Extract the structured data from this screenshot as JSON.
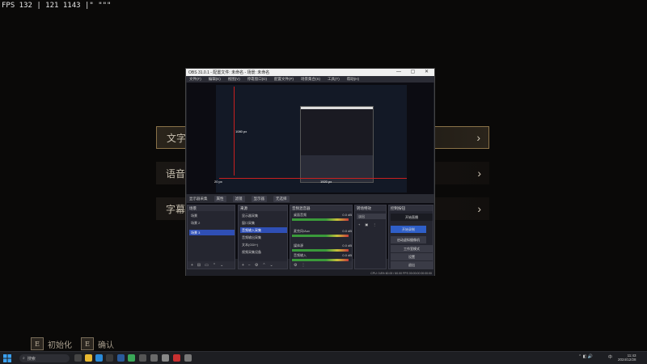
{
  "overlay": {
    "fps_text": "FPS 132 | 121 1143 |\" \"\"\""
  },
  "game_menu": {
    "items": [
      {
        "label": "文字",
        "suffix": ""
      },
      {
        "label": "语音",
        "suffix": ""
      },
      {
        "label": "字幕",
        "suffix": ""
      }
    ],
    "options": [
      {
        "key": "E",
        "label": "初始化"
      },
      {
        "key": "E",
        "label": "确认"
      }
    ]
  },
  "obs": {
    "title": "OBS 31.0.1 - 配置文件: 未命名 - 场景: 未命名",
    "window_buttons": "— ▢ ✕",
    "menu": [
      "文件(F)",
      "编辑(E)",
      "视图(V)",
      "停靠窗口(D)",
      "配置文件(P)",
      "场景集合(S)",
      "工具(T)",
      "帮助(H)"
    ],
    "preview": {
      "height_label": "1080 px",
      "width_label": "1920 px",
      "corner_label": "20 px"
    },
    "toolbar": {
      "source_name": "显示器采集",
      "buttons": [
        "属性",
        "滤镜",
        "显示器",
        "无选择"
      ]
    },
    "docks": {
      "scenes": {
        "title": "场景",
        "items": [
          "场景",
          "场景 2",
          "场景 3"
        ],
        "selected": 2
      },
      "sources": {
        "title": "来源",
        "items": [
          "显示器采集",
          "窗口采集",
          "音频输入采集",
          "音频输出采集",
          "文本(GDI+)",
          "视频采集设备"
        ],
        "selected": 2
      },
      "mixer": {
        "title": "音频混音器",
        "channels": [
          {
            "name": "桌面音频",
            "db": "0.0 dB"
          },
          {
            "name": "麦克风/Aux",
            "db": "0.0 dB"
          },
          {
            "name": "媒体源",
            "db": "0.0 dB"
          },
          {
            "name": "音频输入",
            "db": "0.0 dB"
          }
        ]
      },
      "transitions": {
        "title": "转场特效",
        "type": "淡出",
        "duration_label": "时长",
        "duration": "300 ms"
      },
      "controls": {
        "title": "控制按钮",
        "buttons": [
          "开始直播",
          "开始录制",
          "启动虚拟摄像机",
          "工作室模式",
          "设置",
          "退出"
        ],
        "active": 1
      }
    },
    "status": {
      "text": "CPU: 0.8%  60.00 / 60.00 FPS  00:00:00  00:00:00"
    }
  },
  "taskbar": {
    "search_placeholder": "搜索",
    "time": "11:43",
    "date": "2024/12/28",
    "lang": "中"
  }
}
